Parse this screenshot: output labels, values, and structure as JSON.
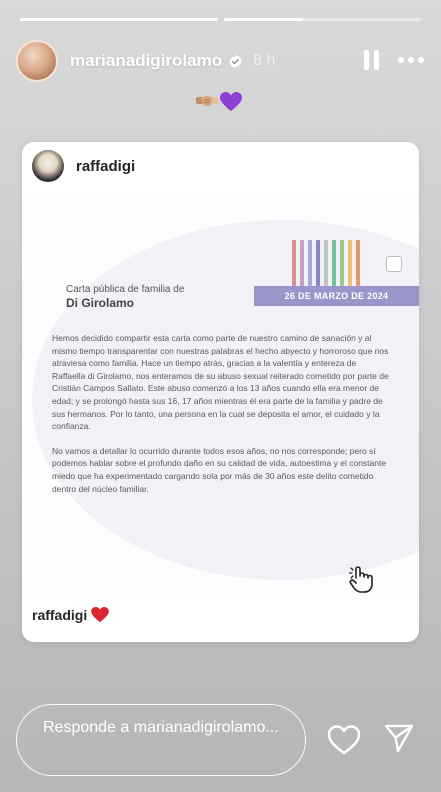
{
  "story": {
    "progress": [
      1.0,
      0.4
    ],
    "username": "marianadigirolamo",
    "time": "8 h"
  },
  "icons": {
    "verified": "verified-badge-icon",
    "pause": "pause-icon",
    "more": "more-options-icon",
    "heart": "heart-icon",
    "send": "send-icon",
    "emojis": [
      "handshake-emoji-icon",
      "purple-heart-emoji-icon"
    ]
  },
  "post": {
    "username": "raffadigi",
    "caption_user": "raffadigi"
  },
  "letter": {
    "subtitle": "Carta pública de familia de",
    "title": "Di Girolamo",
    "date": "26 DE MARZO DE 2024",
    "paragraphs": [
      "Hemos decidido compartir esta carta como parte de nuestro camino de sanación y al mismo tiempo transparentar con nuestras palabras el hecho abyecto y horroroso que nos atraviesa como familia. Hace un tiempo atrás, gracias a la valentía y entereza de Raffaella di Girolamo, nos enteramos de su abuso sexual reiterado cometido por parte de Cristián Campos Sallato. Este abuso comenzó a los 13 años cuando ella era menor de edad; y se prolongó hasta sus 16, 17 años mientras él era parte de la familia y padre de sus hermanos. Por lo tanto, una persona en la cual se deposita el amor, el cuidado y la confianza.",
      "No vamos a detallar lo ocurrido durante todos esos años, no nos corresponde; pero sí podemos hablar sobre el profundo daño en su calidad de vida, autoestima y el constante miedo que ha experimentado cargando sola por más de 30 años este delito cometido dentro del núcleo familiar."
    ],
    "stripe_colors": [
      "#d98c8c",
      "#c9a0c5",
      "#a8a8d8",
      "#8a86c4",
      "#c2c2c2",
      "#6fbf9a",
      "#9bc98b",
      "#e6c27a",
      "#e39a6a"
    ]
  },
  "reply": {
    "placeholder": "Responde a marianadigirolamo..."
  },
  "colors": {
    "band": "#9b96c9",
    "heart_red": "#e0242f",
    "purple_heart": "#8e3fd6"
  }
}
